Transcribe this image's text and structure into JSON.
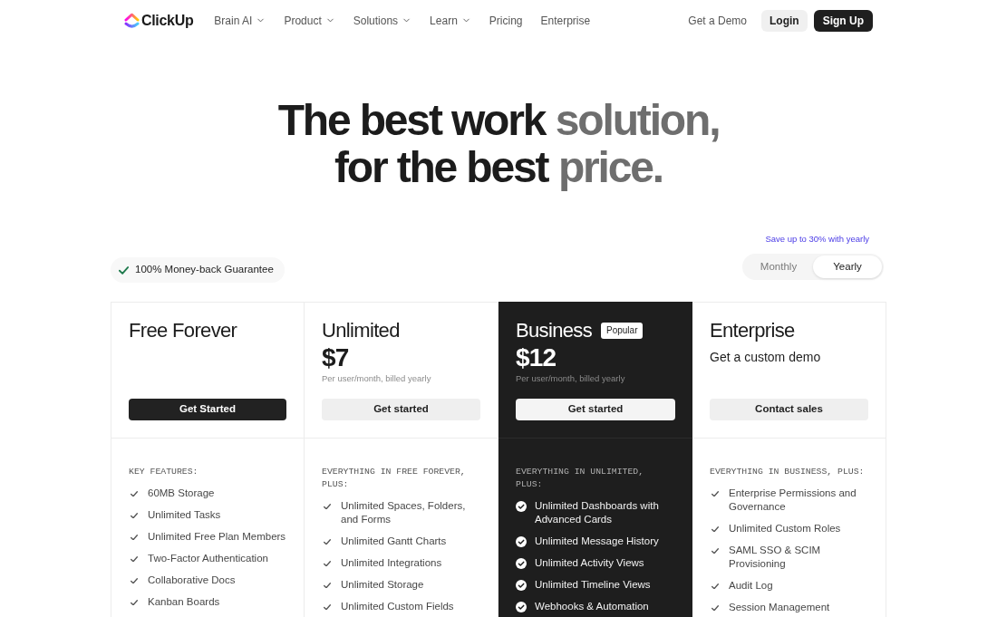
{
  "nav": {
    "logo": "ClickUp",
    "items": [
      {
        "label": "Brain AI",
        "dropdown": true
      },
      {
        "label": "Product",
        "dropdown": true
      },
      {
        "label": "Solutions",
        "dropdown": true
      },
      {
        "label": "Learn",
        "dropdown": true
      },
      {
        "label": "Pricing",
        "dropdown": false
      },
      {
        "label": "Enterprise",
        "dropdown": false
      }
    ],
    "demo_link": "Get a Demo",
    "login_button": "Login",
    "signup_button": "Sign Up"
  },
  "hero": {
    "headline": [
      [
        {
          "text": "The best work",
          "muted": false
        },
        {
          "text": "solution,",
          "muted": true
        }
      ],
      [
        {
          "text": "for the best",
          "muted": false
        },
        {
          "text": "price.",
          "muted": true
        }
      ]
    ]
  },
  "billing": {
    "guarantee": "100% Money-back Guarantee",
    "savings_note": "Save up to 30% with yearly",
    "options": [
      {
        "label": "Monthly",
        "selected": false
      },
      {
        "label": "Yearly",
        "selected": true
      }
    ]
  },
  "plans": [
    {
      "name": "Free Forever",
      "featured": false,
      "button": {
        "label": "Get Started",
        "kind": "dark"
      },
      "features_heading": "KEY FEATURES:",
      "features": [
        "60MB Storage",
        "Unlimited Tasks",
        "Unlimited Free Plan Members",
        "Two-Factor Authentication",
        "Collaborative Docs",
        "Kanban Boards"
      ]
    },
    {
      "name": "Unlimited",
      "featured": false,
      "price": "$7",
      "price_note": "Per user/month, billed yearly",
      "button": {
        "label": "Get started",
        "kind": "light"
      },
      "features_heading": "EVERYTHING IN FREE FOREVER, PLUS:",
      "features": [
        "Unlimited Spaces, Folders, and Forms",
        "Unlimited Gantt Charts",
        "Unlimited Integrations",
        "Unlimited Storage",
        "Unlimited Custom Fields"
      ]
    },
    {
      "name": "Business",
      "badge": "Popular",
      "featured": true,
      "price": "$12",
      "price_note": "Per user/month, billed yearly",
      "button": {
        "label": "Get started",
        "kind": "light"
      },
      "features_heading": "EVERYTHING IN UNLIMITED, PLUS:",
      "features": [
        "Unlimited Dashboards with Advanced Cards",
        "Unlimited Message History",
        "Unlimited Activity Views",
        "Unlimited Timeline Views",
        "Webhooks & Automation"
      ]
    },
    {
      "name": "Enterprise",
      "featured": false,
      "tagline": "Get a custom demo",
      "button": {
        "label": "Contact sales",
        "kind": "light"
      },
      "features_heading": "EVERYTHING IN BUSINESS, PLUS:",
      "features": [
        "Enterprise Permissions and Governance",
        "Unlimited Custom Roles",
        "SAML SSO & SCIM Provisioning",
        "Audit Log",
        "Session Management"
      ]
    }
  ]
}
